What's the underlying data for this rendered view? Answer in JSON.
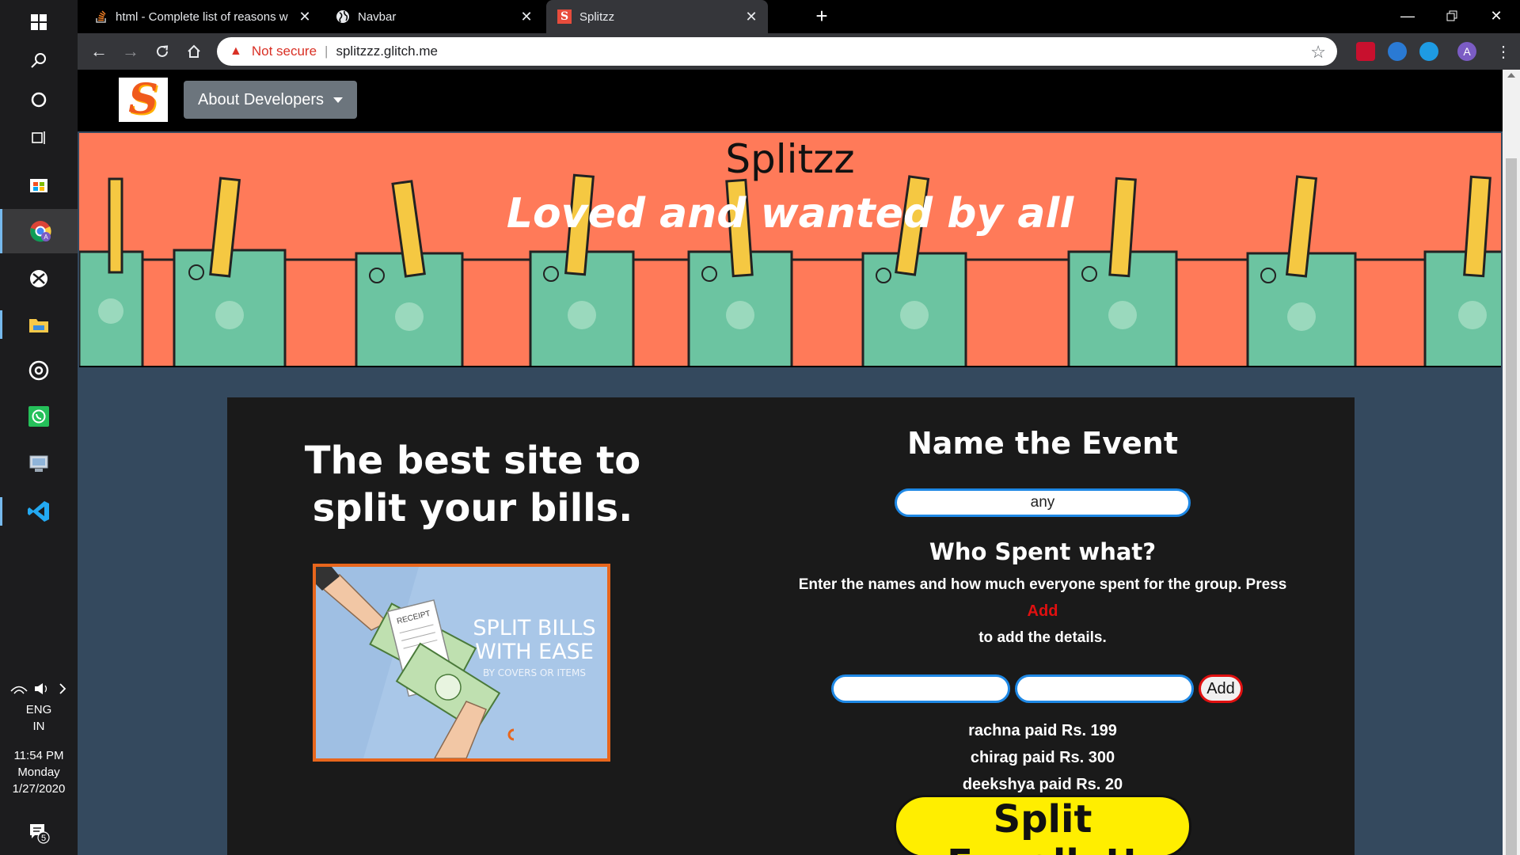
{
  "taskbar": {
    "lang_line1": "ENG",
    "lang_line2": "IN",
    "time": "11:54 PM",
    "day": "Monday",
    "date": "1/27/2020",
    "notification_count": "5"
  },
  "browser": {
    "tabs": [
      {
        "title": "html - Complete list of reasons w"
      },
      {
        "title": "Navbar"
      },
      {
        "title": "Splitzz"
      }
    ],
    "security_label": "Not secure",
    "url": "splitzzz.glitch.me",
    "profile_initial": "A"
  },
  "site": {
    "logo_letter": "S",
    "nav_dropdown_label": "About Developers",
    "banner_title": "Splitzz",
    "banner_tagline": "Loved and wanted by all",
    "headline": "The best site to split your bills.",
    "promo": {
      "line1": "SPLIT BILLS",
      "line2": "WITH EASE",
      "line3": "BY COVERS OR ITEMS",
      "receipt": "RECEIPT"
    },
    "event_heading": "Name the Event",
    "event_value": "any",
    "who_heading": "Who Spent what?",
    "instr_line1": "Enter the names and how much everyone spent for the group. Press",
    "instr_add": "Add",
    "instr_line2": "to add the details.",
    "add_button": "Add",
    "payments": [
      "rachna paid Rs. 199",
      "chirag paid Rs. 300",
      "deekshya paid Rs. 20"
    ],
    "split_button": "Split Equally!!"
  }
}
